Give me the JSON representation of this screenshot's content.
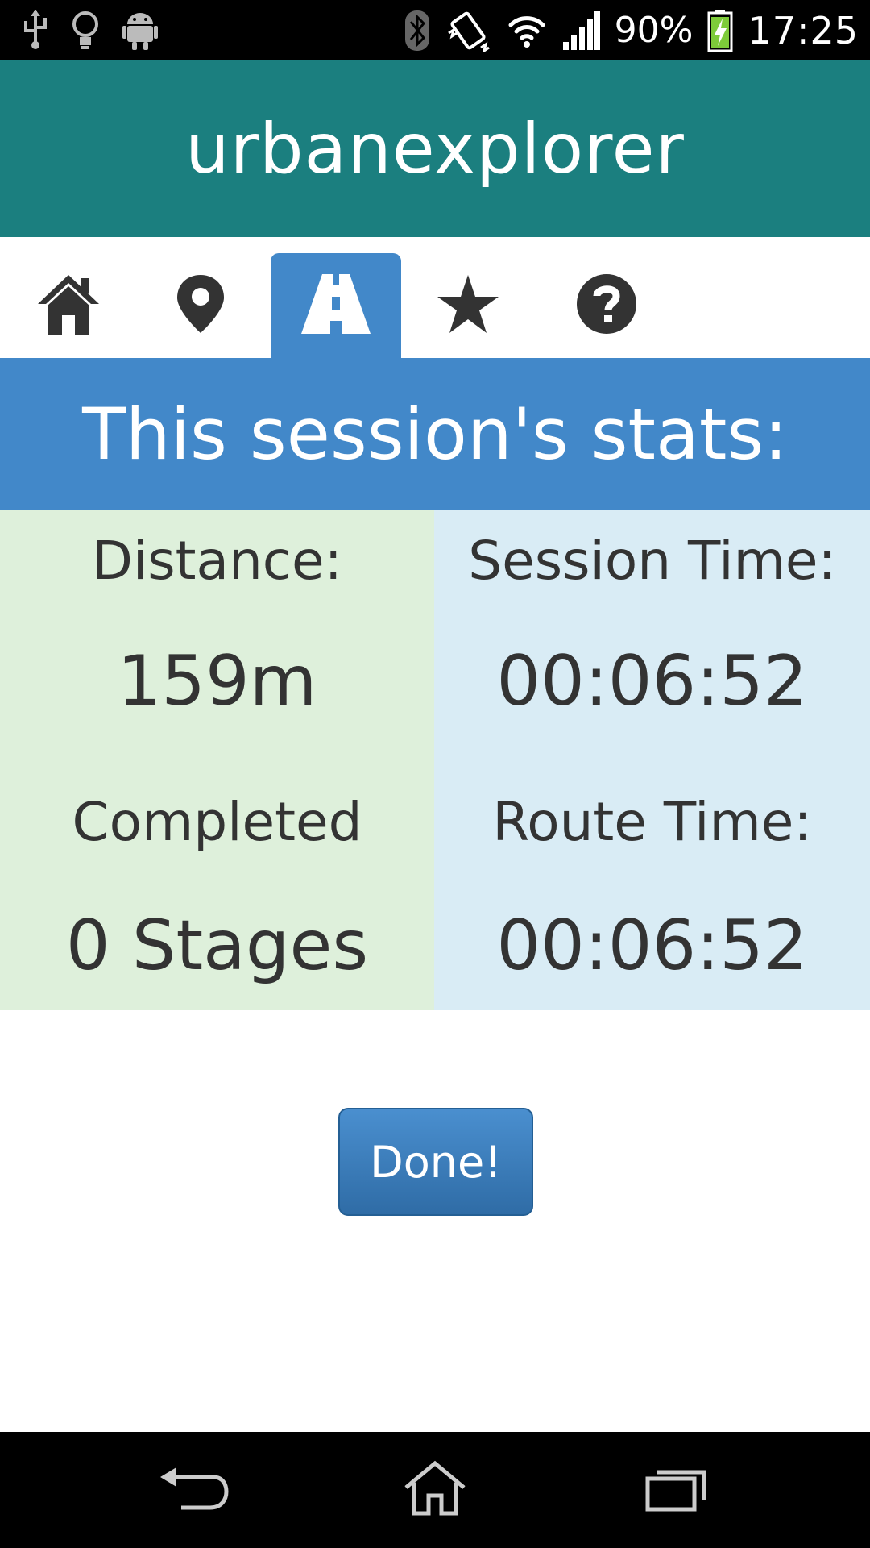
{
  "status_bar": {
    "battery_percent": "90%",
    "time": "17:25",
    "icons": [
      "usb-icon",
      "lightbulb-icon",
      "android-icon",
      "bluetooth-icon",
      "vibrate-icon",
      "wifi-icon",
      "signal-icon",
      "battery-charging-icon"
    ]
  },
  "app": {
    "title": "urbanexplorer",
    "header_color": "#1b7f7f",
    "accent_color": "#4288c9"
  },
  "tabs": [
    {
      "icon": "home-icon",
      "active": false
    },
    {
      "icon": "map-pin-icon",
      "active": false
    },
    {
      "icon": "road-icon",
      "active": true
    },
    {
      "icon": "star-icon",
      "active": false
    },
    {
      "icon": "question-icon",
      "active": false
    }
  ],
  "banner": {
    "title": "This session's stats:"
  },
  "stats": {
    "distance_label": "Distance:",
    "distance_value": "159m",
    "completed_label": "Completed",
    "completed_value": "0 Stages",
    "session_time_label": "Session Time:",
    "session_time_value": "00:06:52",
    "route_time_label": "Route Time:",
    "route_time_value": "00:06:52"
  },
  "actions": {
    "done_label": "Done!"
  },
  "nav_bar": {
    "icons": [
      "back-icon",
      "home-outline-icon",
      "recent-apps-icon"
    ]
  }
}
